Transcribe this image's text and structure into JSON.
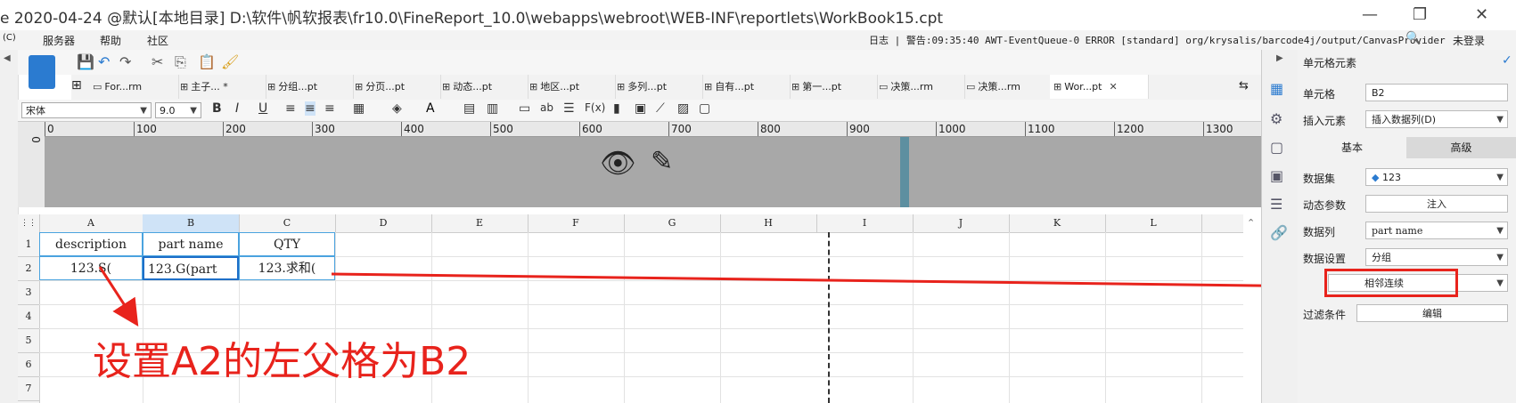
{
  "window": {
    "title": "e 2020-04-24 @默认[本地目录]    D:\\软件\\帆软报表\\fr10.0\\FineReport_10.0\\webapps\\webroot\\WEB-INF\\reportlets\\WorkBook15.cpt",
    "minimize": "—",
    "restore": "❐",
    "close": "✕"
  },
  "menubar": {
    "app_icon": "(C)",
    "items": [
      "服务器",
      "帮助",
      "社区"
    ],
    "log_label": "日志",
    "warning_text": "警告:09:35:40 AWT-EventQueue-0 ERROR [standard] org/krysalis/barcode4j/output/CanvasProvider",
    "login": "未登录"
  },
  "tabs": [
    {
      "label": "For...rm"
    },
    {
      "label": "主子...  *"
    },
    {
      "label": "分组...pt"
    },
    {
      "label": "分页...pt"
    },
    {
      "label": "动态...pt"
    },
    {
      "label": "地区...pt"
    },
    {
      "label": "多列...pt"
    },
    {
      "label": "自有...pt"
    },
    {
      "label": "第一...pt"
    },
    {
      "label": "决策...rm"
    },
    {
      "label": "决策...rm"
    },
    {
      "label": "Wor...pt"
    }
  ],
  "format": {
    "font": "宋体",
    "size": "9.0"
  },
  "ruler": {
    "vertical_zero": "0",
    "ticks": [
      "0",
      "100",
      "200",
      "300",
      "400",
      "500",
      "600",
      "700",
      "800",
      "900",
      "1000",
      "1100",
      "1200",
      "1300"
    ]
  },
  "grid": {
    "columns": [
      "A",
      "B",
      "C",
      "D",
      "E",
      "F",
      "G",
      "H",
      "I",
      "J",
      "K",
      "L"
    ],
    "rows": [
      "1",
      "2",
      "3",
      "4",
      "5",
      "6",
      "7"
    ],
    "cells": {
      "A1": "description",
      "B1": "part name",
      "C1": "QTY",
      "A2": "123.S(",
      "B2": "123.G(part",
      "C2": "123.求和("
    }
  },
  "annotation": "设置A2的左父格为B2",
  "panel": {
    "title": "单元格元素",
    "cell_label": "单元格",
    "cell_value": "B2",
    "insert_label": "插入元素",
    "insert_value": "插入数据列(D)",
    "tab_basic": "基本",
    "tab_advanced": "高级",
    "dataset_label": "数据集",
    "dataset_value": "123",
    "dynamic_label": "动态参数",
    "dynamic_button": "注入",
    "column_label": "数据列",
    "column_value": "part name",
    "setting_label": "数据设置",
    "setting_value": "分组",
    "group_mode": "相邻连续",
    "filter_label": "过滤条件",
    "filter_button": "编辑"
  },
  "colors": {
    "annotation_red": "#e8231c",
    "selection_blue": "#2b7bd0"
  }
}
